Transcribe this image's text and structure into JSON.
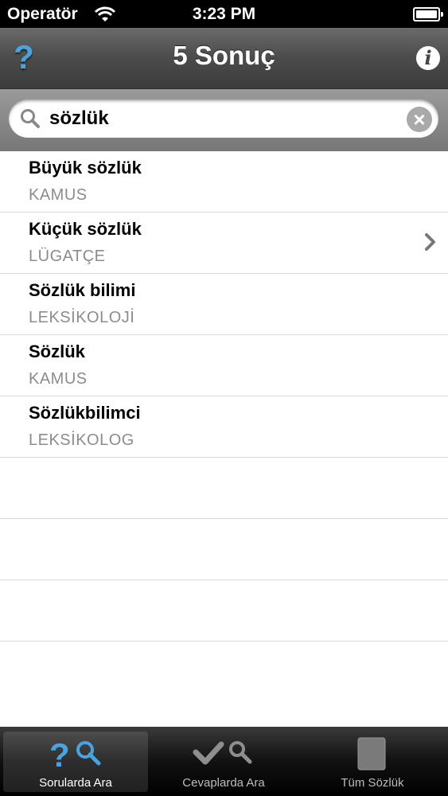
{
  "status_bar": {
    "carrier": "Operatör",
    "time": "3:23 PM"
  },
  "nav": {
    "title": "5 Sonuç",
    "help_icon": "question-mark",
    "info_icon": "info"
  },
  "search": {
    "value": "sözlük"
  },
  "results": [
    {
      "term": "Büyük sözlük",
      "translation": "KAMUS",
      "chevron": false
    },
    {
      "term": "Küçük sözlük",
      "translation": "LÜGATÇE",
      "chevron": true
    },
    {
      "term": "Sözlük bilimi",
      "translation": "LEKSİKOLOJİ",
      "chevron": false
    },
    {
      "term": "Sözlük",
      "translation": "KAMUS",
      "chevron": false
    },
    {
      "term": "Sözlükbilimci",
      "translation": "LEKSİKOLOG",
      "chevron": false
    }
  ],
  "tabs": [
    {
      "label": "Sorularda Ara",
      "selected": true
    },
    {
      "label": "Cevaplarda Ara",
      "selected": false
    },
    {
      "label": "Tüm Sözlük",
      "selected": false
    }
  ],
  "colors": {
    "accent": "#4aa3df"
  }
}
